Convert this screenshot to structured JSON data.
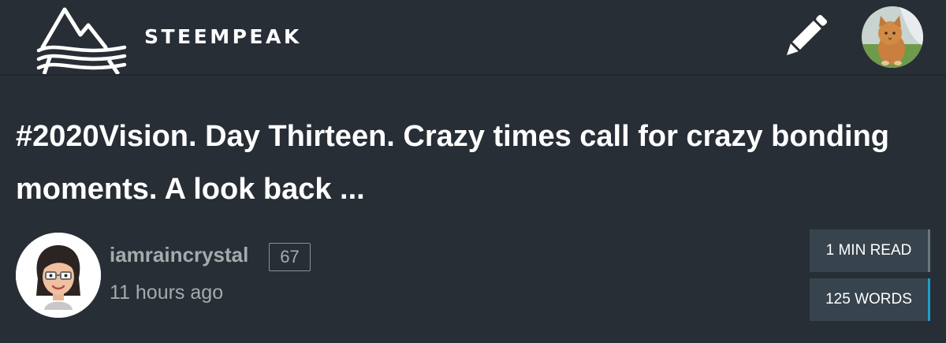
{
  "header": {
    "brand": "STEEMPEAK",
    "logo_icon": "steempeak-mountain-logo",
    "compose_icon": "pencil-icon",
    "user_avatar": "kitten-avatar"
  },
  "post": {
    "title": "#2020Vision. Day Thirteen. Crazy times call for crazy bonding moments. A look back ...",
    "author": {
      "name": "iamraincrystal",
      "reputation": "67",
      "avatar": "cartoon-woman-avatar"
    },
    "timestamp": "11 hours ago",
    "stats": {
      "read_time": "1 MIN READ",
      "word_count": "125 WORDS"
    }
  },
  "colors": {
    "background": "#272e35",
    "stat_box": "#37444e",
    "muted_text": "#a7aaad",
    "accent": "#1a9fc6"
  }
}
